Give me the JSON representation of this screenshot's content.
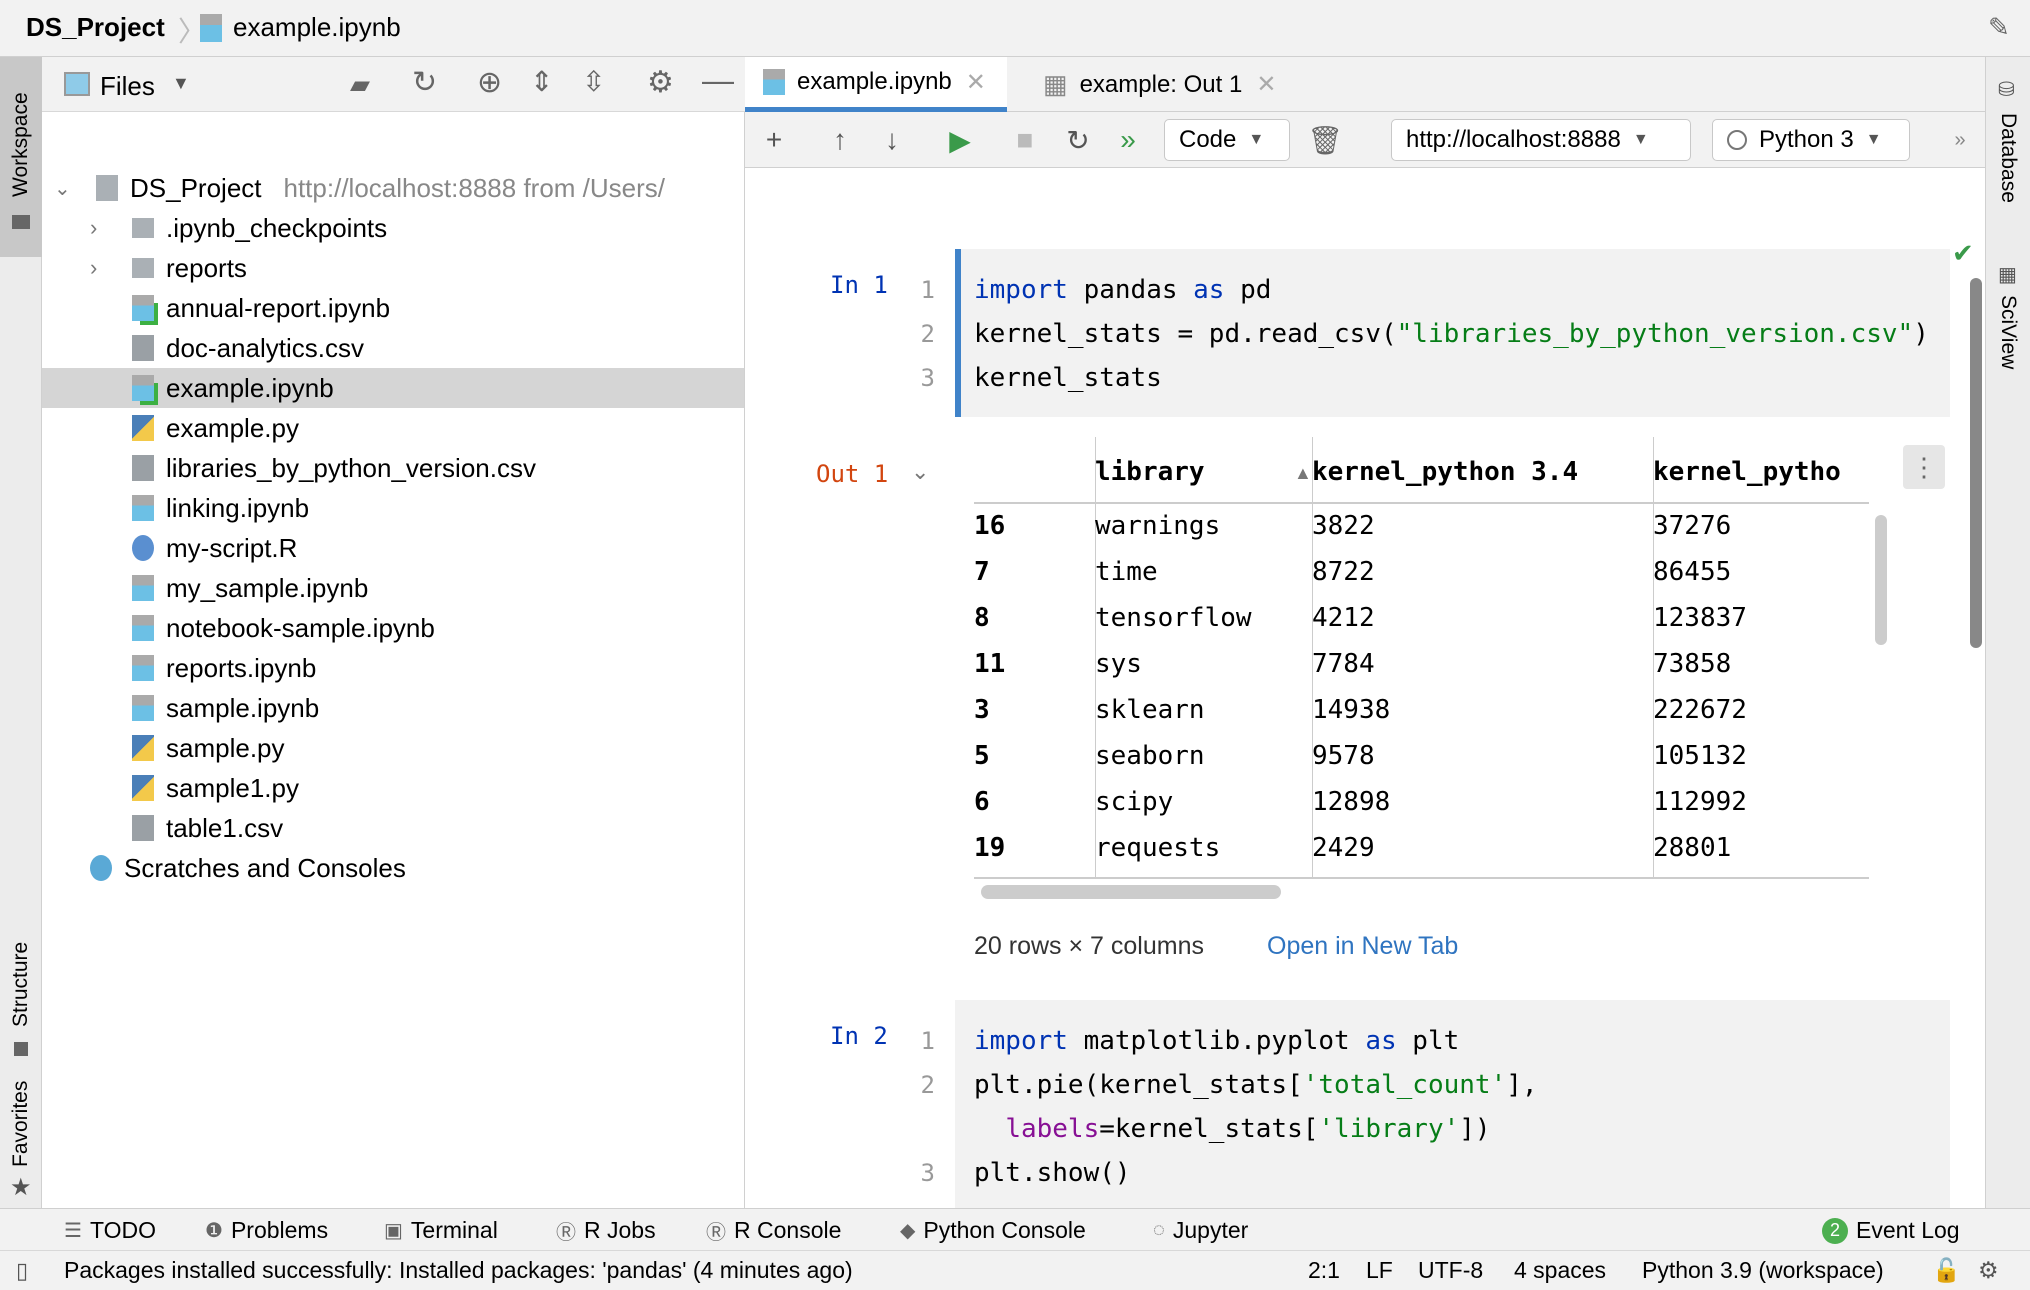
{
  "breadcrumb": {
    "project": "DS_Project",
    "file": "example.ipynb"
  },
  "left_strip": {
    "workspace": "Workspace",
    "structure": "Structure",
    "favorites": "Favorites"
  },
  "right_strip": {
    "database": "Database",
    "sciview": "SciView"
  },
  "project_panel": {
    "view_label": "Files",
    "root": {
      "name": "DS_Project",
      "hint": "http://localhost:8888 from /Users/"
    },
    "items": [
      {
        "name": ".ipynb_checkpoints",
        "type": "folder"
      },
      {
        "name": "reports",
        "type": "folder"
      },
      {
        "name": "annual-report.ipynb",
        "type": "ipynb-active"
      },
      {
        "name": "doc-analytics.csv",
        "type": "csv"
      },
      {
        "name": "example.ipynb",
        "type": "ipynb-active",
        "selected": true
      },
      {
        "name": "example.py",
        "type": "py"
      },
      {
        "name": "libraries_by_python_version.csv",
        "type": "csv"
      },
      {
        "name": "linking.ipynb",
        "type": "ipynb"
      },
      {
        "name": "my-script.R",
        "type": "r"
      },
      {
        "name": "my_sample.ipynb",
        "type": "ipynb"
      },
      {
        "name": "notebook-sample.ipynb",
        "type": "ipynb"
      },
      {
        "name": "reports.ipynb",
        "type": "ipynb"
      },
      {
        "name": "sample.ipynb",
        "type": "ipynb"
      },
      {
        "name": "sample.py",
        "type": "py"
      },
      {
        "name": "sample1.py",
        "type": "py"
      },
      {
        "name": "table1.csv",
        "type": "csv"
      }
    ],
    "scratches": "Scratches and Consoles"
  },
  "tabs": [
    {
      "label": "example.ipynb",
      "active": true
    },
    {
      "label": "example: Out 1",
      "active": false
    }
  ],
  "toolbar": {
    "cell_type": "Code",
    "server": "http://localhost:8888",
    "kernel": "Python 3"
  },
  "cells": [
    {
      "prompt": "In 1",
      "lines": [
        {
          "num": "1",
          "tokens": [
            {
              "t": "import",
              "c": "kw"
            },
            {
              "t": " pandas ",
              "c": ""
            },
            {
              "t": "as",
              "c": "kw"
            },
            {
              "t": " pd",
              "c": ""
            }
          ]
        },
        {
          "num": "2",
          "tokens": [
            {
              "t": "kernel_stats = pd.read_csv(",
              "c": ""
            },
            {
              "t": "\"libraries_by_python_version.csv\"",
              "c": "str"
            },
            {
              "t": ")",
              "c": ""
            }
          ]
        },
        {
          "num": "3",
          "tokens": [
            {
              "t": "kernel_stats",
              "c": ""
            }
          ]
        }
      ]
    },
    {
      "prompt": "In 2",
      "lines": [
        {
          "num": "1",
          "tokens": [
            {
              "t": "import",
              "c": "kw"
            },
            {
              "t": " matplotlib.pyplot ",
              "c": ""
            },
            {
              "t": "as",
              "c": "kw"
            },
            {
              "t": " plt",
              "c": ""
            }
          ]
        },
        {
          "num": "2",
          "tokens": [
            {
              "t": "plt.pie(kernel_stats[",
              "c": ""
            },
            {
              "t": "'total_count'",
              "c": "str"
            },
            {
              "t": "],",
              "c": ""
            }
          ]
        },
        {
          "num": "",
          "tokens": [
            {
              "t": "  ",
              "c": ""
            },
            {
              "t": "labels",
              "c": "param"
            },
            {
              "t": "=kernel_stats[",
              "c": ""
            },
            {
              "t": "'library'",
              "c": "str"
            },
            {
              "t": "])",
              "c": ""
            }
          ]
        },
        {
          "num": "3",
          "tokens": [
            {
              "t": "plt.show()",
              "c": ""
            }
          ]
        }
      ]
    }
  ],
  "output": {
    "prompt": "Out 1",
    "columns": [
      "",
      "library",
      "kernel_python 3.4",
      "kernel_pytho"
    ],
    "rows": [
      [
        "16",
        "warnings",
        "3822",
        "37276"
      ],
      [
        "7",
        "time",
        "8722",
        "86455"
      ],
      [
        "8",
        "tensorflow",
        "4212",
        "123837"
      ],
      [
        "11",
        "sys",
        "7784",
        "73858"
      ],
      [
        "3",
        "sklearn",
        "14938",
        "222672"
      ],
      [
        "5",
        "seaborn",
        "9578",
        "105132"
      ],
      [
        "6",
        "scipy",
        "12898",
        "112992"
      ],
      [
        "19",
        "requests",
        "2429",
        "28801"
      ]
    ],
    "summary": "20 rows × 7 columns",
    "open_link": "Open in New Tab"
  },
  "bottom_tools": [
    "TODO",
    "Problems",
    "Terminal",
    "R Jobs",
    "R Console",
    "Python Console",
    "Jupyter"
  ],
  "event_log": {
    "count": "2",
    "label": "Event Log"
  },
  "status": {
    "message": "Packages installed successfully: Installed packages: 'pandas' (4 minutes ago)",
    "position": "2:1",
    "line_sep": "LF",
    "encoding": "UTF-8",
    "indent": "4 spaces",
    "interpreter": "Python 3.9 (workspace)"
  }
}
